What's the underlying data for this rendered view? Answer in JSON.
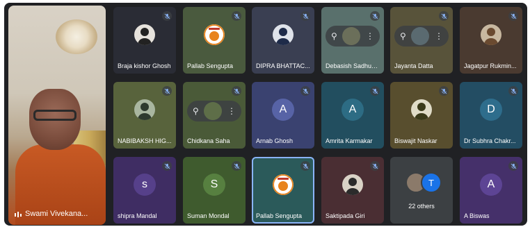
{
  "speaker": {
    "name": "Swami Vivekana...",
    "pin_label": ""
  },
  "tiles": [
    {
      "name": "Braja kishor Ghosh",
      "bg": "#2a2c35",
      "type": "photo",
      "photo": "#e6e2dc",
      "fg": "#222"
    },
    {
      "name": "Pallab Sengupta",
      "bg": "#4a5a3e",
      "type": "logo"
    },
    {
      "name": "DIPRA BHATTAC...",
      "bg": "#3a3f52",
      "type": "photo",
      "photo": "#dfe3ea",
      "fg": "#1e2b49"
    },
    {
      "name": "Debasish Sadhuk...",
      "bg": "#59706c",
      "type": "pill",
      "face": "#6b6f5a"
    },
    {
      "name": "Jayanta Datta",
      "bg": "#58533a",
      "type": "pill",
      "face": "#5a6a70"
    },
    {
      "name": "Jagatpur Rukmin...",
      "bg": "#4a3a30",
      "type": "photo",
      "photo": "#c8b8a0",
      "fg": "#6a4a30"
    },
    {
      "name": "NABIBAKSH HIG...",
      "bg": "#58633c",
      "type": "photo",
      "photo": "#a9b6a0",
      "fg": "#2e3a2e"
    },
    {
      "name": "Chidkana Saha",
      "bg": "#4a5a38",
      "type": "pill",
      "face": "#5e6e48"
    },
    {
      "name": "Arnab Ghosh",
      "bg": "#3a4270",
      "type": "letter",
      "letter": "A",
      "av": "#5763a6"
    },
    {
      "name": "Amrita Karmakar",
      "bg": "#224e5f",
      "type": "letter",
      "letter": "A",
      "av": "#2d6c84"
    },
    {
      "name": "Biswajit Naskar",
      "bg": "#584e2e",
      "type": "photo",
      "photo": "#e0dcc8",
      "fg": "#3a3a1a"
    },
    {
      "name": "Dr Subhra Chakr...",
      "bg": "#234d63",
      "type": "letter",
      "letter": "D",
      "av": "#2e6d8c"
    },
    {
      "name": "shipra Mandal",
      "bg": "#3f2d63",
      "type": "letter",
      "letter": "s",
      "av": "#56408a"
    },
    {
      "name": "Suman Mondal",
      "bg": "#3f5b2e",
      "type": "letter",
      "letter": "S",
      "av": "#578040"
    },
    {
      "name": "Pallab Sengupta",
      "bg": "#2b5a5a",
      "type": "logo",
      "active": true
    },
    {
      "name": "Saktipada Giri",
      "bg": "#4a2e33",
      "type": "photo",
      "photo": "#d9d2c6",
      "fg": "#2b2b2b"
    },
    {
      "name": "22 others",
      "bg": "#3c4043",
      "type": "others",
      "letter": "T"
    },
    {
      "name": "A Biswas",
      "bg": "#45306a",
      "type": "letter",
      "letter": "A",
      "av": "#5d4494"
    }
  ],
  "colors": {
    "mic_icon": "#8ab4f8",
    "logo_ring": "#e8841e",
    "logo_text": "#c0392b"
  }
}
